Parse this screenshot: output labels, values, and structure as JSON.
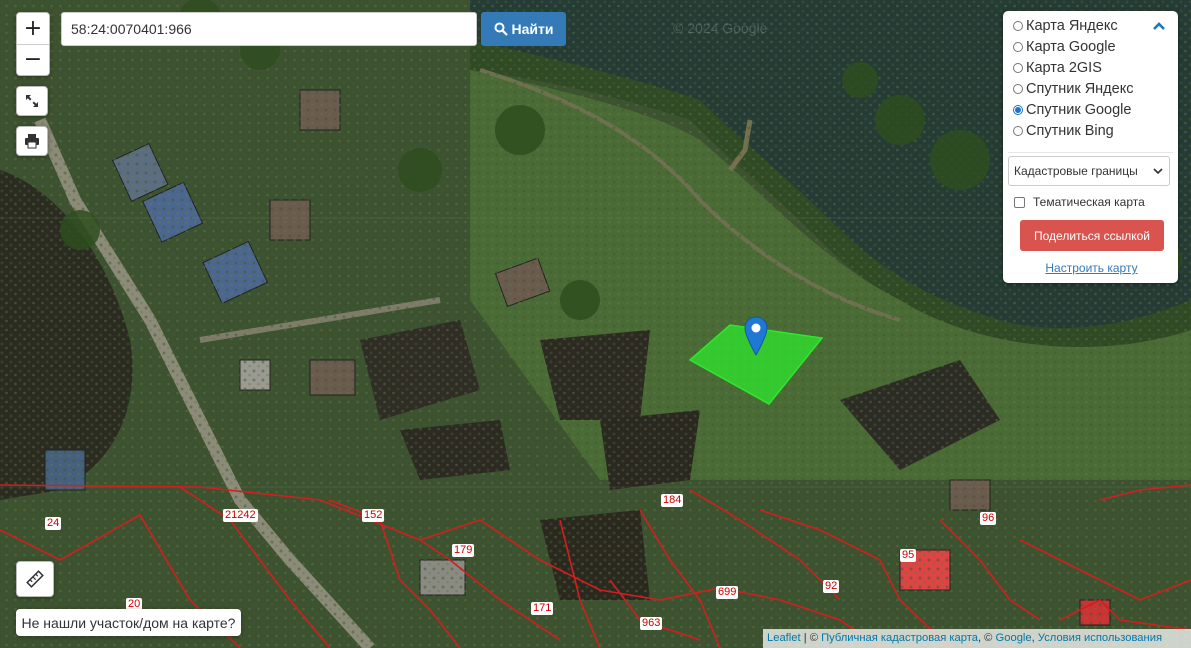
{
  "search": {
    "value": "58:24:0070401:966",
    "button_label": "Найти"
  },
  "zoom": {
    "in": "+",
    "out": "−"
  },
  "watermark": "© 2024 Google",
  "layers": {
    "options": [
      {
        "label": "Карта Яндекс",
        "selected": false
      },
      {
        "label": "Карта Google",
        "selected": false
      },
      {
        "label": "Карта 2GIS",
        "selected": false
      },
      {
        "label": "Спутник Яндекс",
        "selected": false
      },
      {
        "label": "Спутник Google",
        "selected": true
      },
      {
        "label": "Спутник Bing",
        "selected": false
      }
    ],
    "overlay_select": "Кадастровые границы",
    "thematic_label": "Тематическая карта",
    "thematic_checked": false,
    "share_button": "Поделиться ссылкой",
    "settings_link": "Настроить карту"
  },
  "bottom": {
    "not_found": "Не нашли участок/дом на карте?"
  },
  "attribution": {
    "leaflet": "Leaflet",
    "sep1": " | © ",
    "pkk": "Публичная кадастровая карта",
    "sep2": ", © ",
    "google": "Google",
    "sep3": ", ",
    "terms": "Условия использования"
  },
  "parcel_labels": [
    "21242",
    "24",
    "152",
    "179",
    "184",
    "96",
    "95",
    "20",
    "171",
    "699",
    "92",
    "963"
  ],
  "colors": {
    "search_button": "#337ab7",
    "share_button": "#d9534f",
    "parcel_highlight": "#2ee82e",
    "cadastral_lines": "#d41e1e",
    "marker": "#1e78d4"
  },
  "icons": {
    "fullscreen": "expand-icon",
    "print": "print-icon",
    "search": "search-icon",
    "ruler": "ruler-icon",
    "marker": "map-marker-icon",
    "collapse": "chevron-up-icon"
  }
}
